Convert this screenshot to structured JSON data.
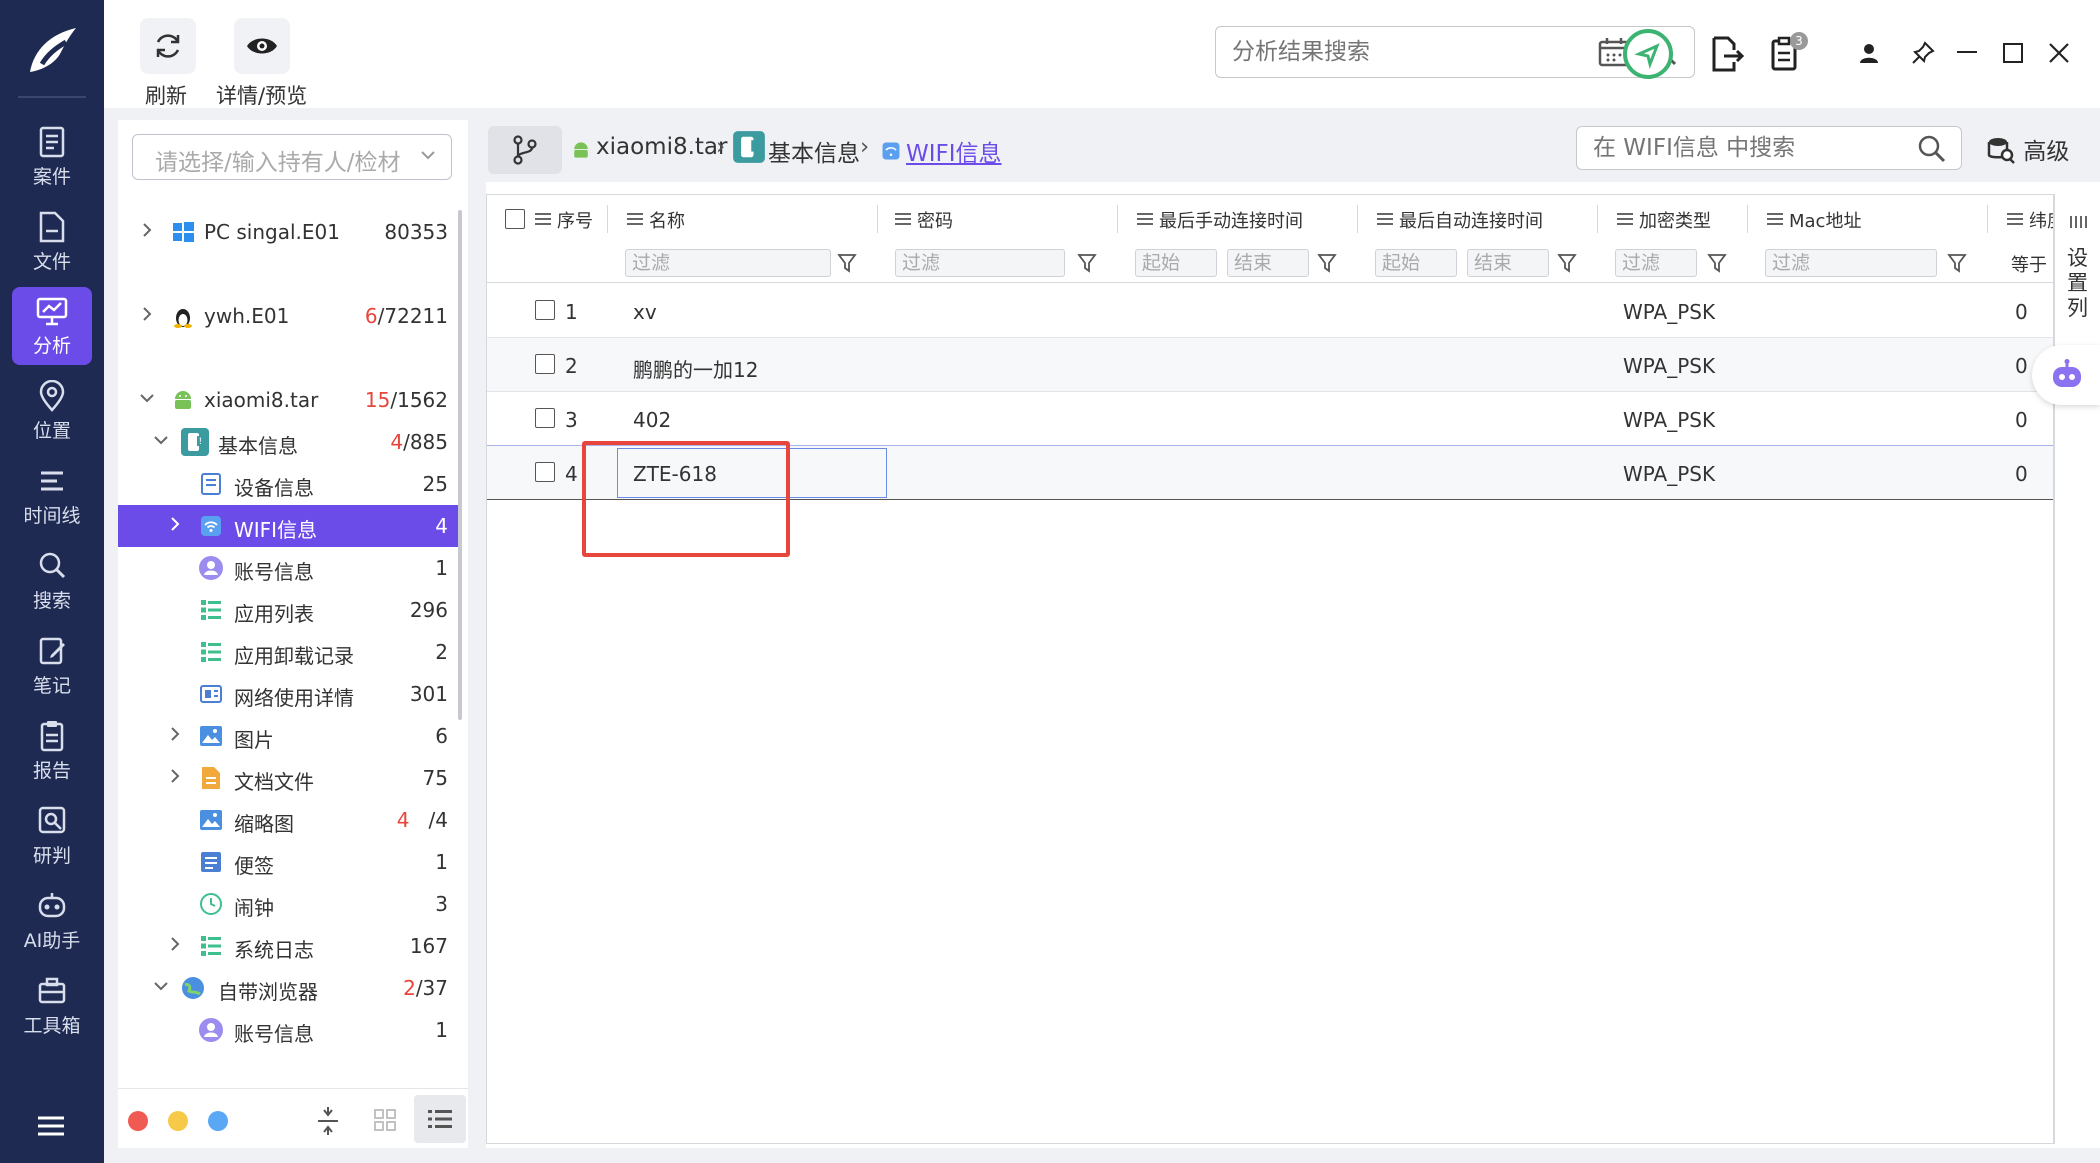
{
  "toolbar": {
    "refresh_label": "刷新",
    "preview_label": "详情/预览"
  },
  "top_search": {
    "placeholder": "分析结果搜索"
  },
  "notification": {
    "count": "3"
  },
  "colors": {
    "nav_bg": "#1e2a52",
    "accent": "#6c4ce8",
    "highlight_red": "#e8453c",
    "status_green": "#3cb371"
  },
  "nav": {
    "items": [
      {
        "label": "案件",
        "icon": "case-icon"
      },
      {
        "label": "文件",
        "icon": "file-icon"
      },
      {
        "label": "分析",
        "icon": "analysis-icon",
        "active": true
      },
      {
        "label": "位置",
        "icon": "location-icon"
      },
      {
        "label": "时间线",
        "icon": "timeline-icon"
      },
      {
        "label": "搜索",
        "icon": "search-icon"
      },
      {
        "label": "笔记",
        "icon": "notes-icon"
      },
      {
        "label": "报告",
        "icon": "report-icon"
      },
      {
        "label": "研判",
        "icon": "judge-icon"
      },
      {
        "label": "AI助手",
        "icon": "robot-icon"
      },
      {
        "label": "工具箱",
        "icon": "toolbox-icon"
      }
    ]
  },
  "tree": {
    "case_placeholder": "请选择/输入持有人/检材",
    "items": [
      {
        "label": "PC singal.E01",
        "count": "80353",
        "count_red": "",
        "icon": "windows-icon"
      },
      {
        "label": "ywh.E01",
        "count": "/72211",
        "count_red": "6",
        "icon": "linux-icon"
      },
      {
        "label": "xiaomi8.tar",
        "count": "/1562",
        "count_red": "15",
        "icon": "android-icon"
      },
      {
        "label": "基本信息",
        "count": "/885",
        "count_red": "4",
        "icon": "basic-info-icon"
      },
      {
        "label": "设备信息",
        "count": "25",
        "count_red": "",
        "icon": "device-info-icon"
      },
      {
        "label": "WIFI信息",
        "count": "4",
        "count_red": "",
        "icon": "wifi-icon"
      },
      {
        "label": "账号信息",
        "count": "1",
        "count_red": "",
        "icon": "account-icon"
      },
      {
        "label": "应用列表",
        "count": "296",
        "count_red": "",
        "icon": "app-list-icon"
      },
      {
        "label": "应用卸载记录",
        "count": "2",
        "count_red": "",
        "icon": "uninstall-icon"
      },
      {
        "label": "网络使用详情",
        "count": "301",
        "count_red": "",
        "icon": "network-icon"
      },
      {
        "label": "图片",
        "count": "6",
        "count_red": "",
        "icon": "image-icon"
      },
      {
        "label": "文档文件",
        "count": "75",
        "count_red": "",
        "icon": "document-icon"
      },
      {
        "label": "缩略图",
        "count": "/4",
        "count_red": "4",
        "icon": "thumbnail-icon"
      },
      {
        "label": "便签",
        "count": "1",
        "count_red": "",
        "icon": "memo-icon"
      },
      {
        "label": "闹钟",
        "count": "3",
        "count_red": "",
        "icon": "alarm-icon"
      },
      {
        "label": "系统日志",
        "count": "167",
        "count_red": "",
        "icon": "syslog-icon"
      },
      {
        "label": "自带浏览器",
        "count": "/37",
        "count_red": "2",
        "icon": "browser-icon"
      },
      {
        "label": "账号信息",
        "count": "1",
        "count_red": "",
        "icon": "account-icon"
      }
    ]
  },
  "breadcrumb": {
    "device": "xiaomi8.tar",
    "category": "基本信息",
    "current": "WIFI信息"
  },
  "main_search": {
    "placeholder": "在 WIFI信息 中搜索"
  },
  "advanced_label": "高级",
  "column_setter_label": "设置列",
  "table": {
    "columns": [
      "序号",
      "名称",
      "密码",
      "最后手动连接时间",
      "最后自动连接时间",
      "加密类型",
      "Mac地址",
      "纬度"
    ],
    "filter_placeholder": "过滤",
    "start_placeholder": "起始",
    "end_placeholder": "结束",
    "equals_label": "等于",
    "rows": [
      {
        "index": "1",
        "name": "xv",
        "password": "",
        "enc": "WPA_PSK",
        "lat": "0"
      },
      {
        "index": "2",
        "name": "鹏鹏的一加12",
        "password": "",
        "enc": "WPA_PSK",
        "lat": "0"
      },
      {
        "index": "3",
        "name": "402",
        "password": "",
        "enc": "WPA_PSK",
        "lat": "0"
      },
      {
        "index": "4",
        "name": "ZTE-618",
        "password": "",
        "enc": "WPA_PSK",
        "lat": "0"
      }
    ]
  }
}
